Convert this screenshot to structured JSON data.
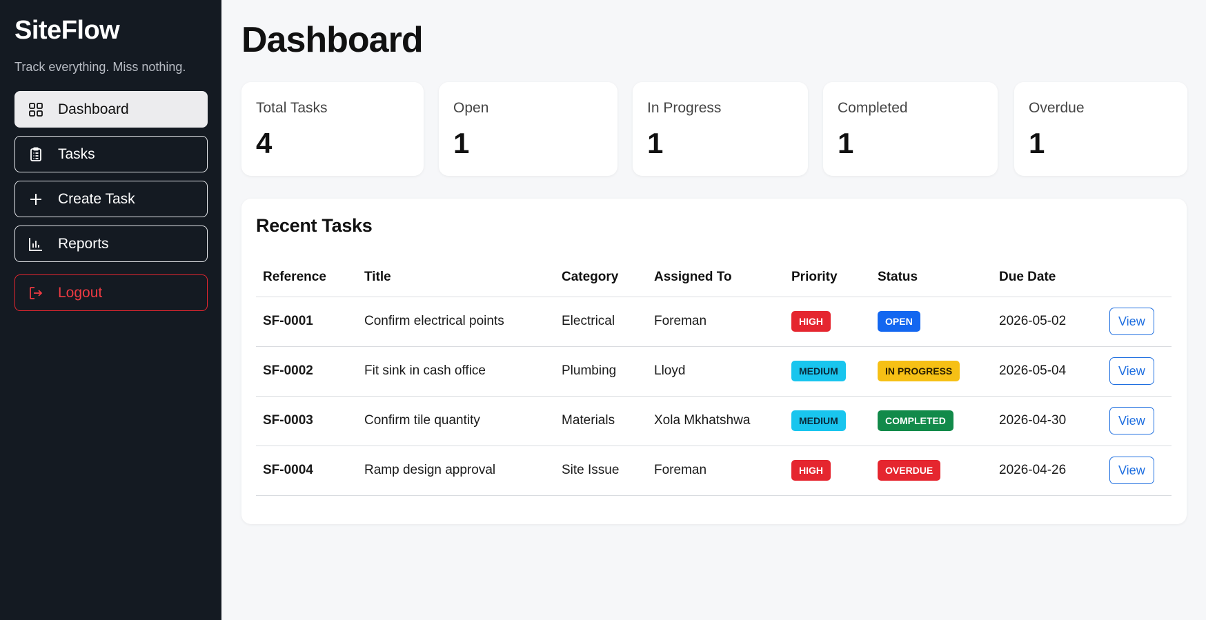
{
  "brand": {
    "title": "SiteFlow",
    "tagline": "Track everything. Miss nothing."
  },
  "nav": [
    {
      "label": "Dashboard",
      "icon": "grid-icon",
      "active": true
    },
    {
      "label": "Tasks",
      "icon": "clipboard-icon",
      "active": false
    },
    {
      "label": "Create Task",
      "icon": "plus-icon",
      "active": false
    },
    {
      "label": "Reports",
      "icon": "bar-chart-icon",
      "active": false
    }
  ],
  "logout": {
    "label": "Logout",
    "icon": "logout-icon",
    "color": "#ee3a42"
  },
  "page": {
    "title": "Dashboard"
  },
  "stats": [
    {
      "label": "Total Tasks",
      "value": "4"
    },
    {
      "label": "Open",
      "value": "1"
    },
    {
      "label": "In Progress",
      "value": "1"
    },
    {
      "label": "Completed",
      "value": "1"
    },
    {
      "label": "Overdue",
      "value": "1"
    }
  ],
  "recent": {
    "title": "Recent Tasks",
    "columns": [
      "Reference",
      "Title",
      "Category",
      "Assigned To",
      "Priority",
      "Status",
      "Due Date"
    ],
    "view_label": "View",
    "rows": [
      {
        "reference": "SF-0001",
        "title": "Confirm electrical points",
        "category": "Electrical",
        "assigned": "Foreman",
        "priority": "HIGH",
        "status": "OPEN",
        "due": "2026-05-02"
      },
      {
        "reference": "SF-0002",
        "title": "Fit sink in cash office",
        "category": "Plumbing",
        "assigned": "Lloyd",
        "priority": "MEDIUM",
        "status": "IN PROGRESS",
        "due": "2026-05-04"
      },
      {
        "reference": "SF-0003",
        "title": "Confirm tile quantity",
        "category": "Materials",
        "assigned": "Xola Mkhatshwa",
        "priority": "MEDIUM",
        "status": "COMPLETED",
        "due": "2026-04-30"
      },
      {
        "reference": "SF-0004",
        "title": "Ramp design approval",
        "category": "Site Issue",
        "assigned": "Foreman",
        "priority": "HIGH",
        "status": "OVERDUE",
        "due": "2026-04-26"
      }
    ]
  },
  "colors": {
    "sidebar_bg": "#141a22",
    "accent_blue": "#1f6fe0",
    "priority": {
      "HIGH": {
        "bg": "#e5262f",
        "fg": "#ffffff"
      },
      "MEDIUM": {
        "bg": "#19c5ee",
        "fg": "#0a2a3a"
      }
    },
    "status": {
      "OPEN": {
        "bg": "#1367f0",
        "fg": "#ffffff"
      },
      "IN PROGRESS": {
        "bg": "#f6c015",
        "fg": "#2a1f00"
      },
      "COMPLETED": {
        "bg": "#128a4a",
        "fg": "#ffffff"
      },
      "OVERDUE": {
        "bg": "#e5262f",
        "fg": "#ffffff"
      }
    }
  }
}
